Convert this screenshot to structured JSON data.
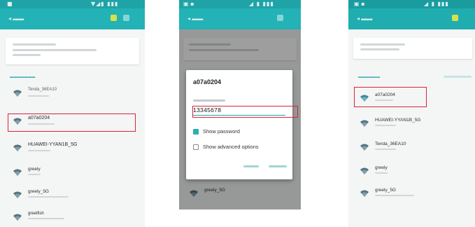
{
  "panel1": {
    "networks": [
      {
        "name": "Tenda_36EA10"
      },
      {
        "name": "a07a0204"
      },
      {
        "name": "HUAWEI-YYAN1B_5G"
      },
      {
        "name": "greely"
      },
      {
        "name": "greely_5G"
      },
      {
        "name": "greelfish"
      }
    ]
  },
  "panel2": {
    "dialog": {
      "title": "a07a0204",
      "password_value": "13345678",
      "show_password_label": "Show password",
      "show_advanced_label": "Show advanced options",
      "show_password_checked": true,
      "show_advanced_checked": false
    },
    "background_network": "greely_5G"
  },
  "panel3": {
    "networks": [
      {
        "name": "a07a0204"
      },
      {
        "name": "HUAWEI-YYAN1B_5G"
      },
      {
        "name": "Tenda_36EA10"
      },
      {
        "name": "greely"
      },
      {
        "name": "greely_5G"
      }
    ]
  },
  "colors": {
    "header": "#23b2b5",
    "status_bar": "#1fa3a6",
    "highlight": "#d9233b",
    "accent": "#2ab0b0"
  },
  "icons": [
    "wifi-signal-icon",
    "checkbox-checked-icon",
    "checkbox-unchecked-icon"
  ]
}
